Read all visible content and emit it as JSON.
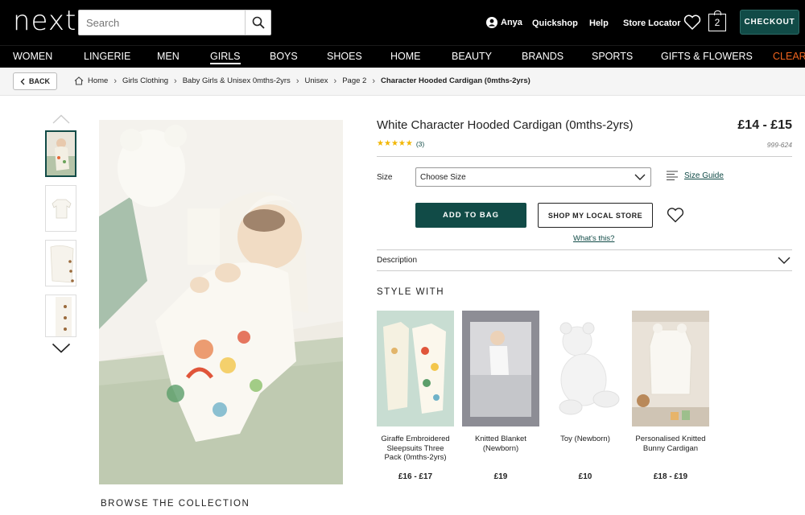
{
  "header": {
    "logo": "next",
    "search_placeholder": "Search",
    "account_name": "Anya",
    "links": [
      "Quickshop",
      "Help",
      "Store Locator"
    ],
    "bag_count": "2",
    "checkout_label": "CHECKOUT"
  },
  "nav": {
    "items": [
      "WOMEN",
      "LINGERIE",
      "MEN",
      "GIRLS",
      "BOYS",
      "SHOES",
      "HOME",
      "BEAUTY",
      "BRANDS",
      "SPORTS",
      "GIFTS & FLOWERS",
      "CLEARA"
    ],
    "active": "GIRLS"
  },
  "breadcrumb": {
    "back_label": "BACK",
    "items": [
      "Home",
      "Girls Clothing",
      "Baby Girls & Unisex 0mths-2yrs",
      "Unisex",
      "Page 2",
      "Character Hooded Cardigan (0mths-2yrs)"
    ]
  },
  "product": {
    "title": "White Character Hooded Cardigan (0mths-2yrs)",
    "price": "£14 - £15",
    "rating_stars": 5,
    "review_count": "(3)",
    "sku": "999-624",
    "size_label": "Size",
    "size_placeholder": "Choose Size",
    "size_guide_label": "Size Guide",
    "add_to_bag_label": "ADD TO BAG",
    "local_store_label": "SHOP MY LOCAL STORE",
    "whats_this_label": "What's this?",
    "description_label": "Description"
  },
  "style_with": {
    "heading": "STYLE WITH",
    "items": [
      {
        "name": "Giraffe Embroidered Sleepsuits Three Pack (0mths-2yrs)",
        "price": "£16 - £17"
      },
      {
        "name": "Knitted Blanket (Newborn)",
        "price": "£19"
      },
      {
        "name": "Toy (Newborn)",
        "price": "£10"
      },
      {
        "name": "Personalised Knitted Bunny Cardigan",
        "price": "£18 - £19"
      }
    ]
  },
  "browse_heading": "BROWSE THE COLLECTION",
  "colors": {
    "brand_teal": "#114b47",
    "sale_orange": "#f1641e",
    "star": "#f2b600"
  }
}
